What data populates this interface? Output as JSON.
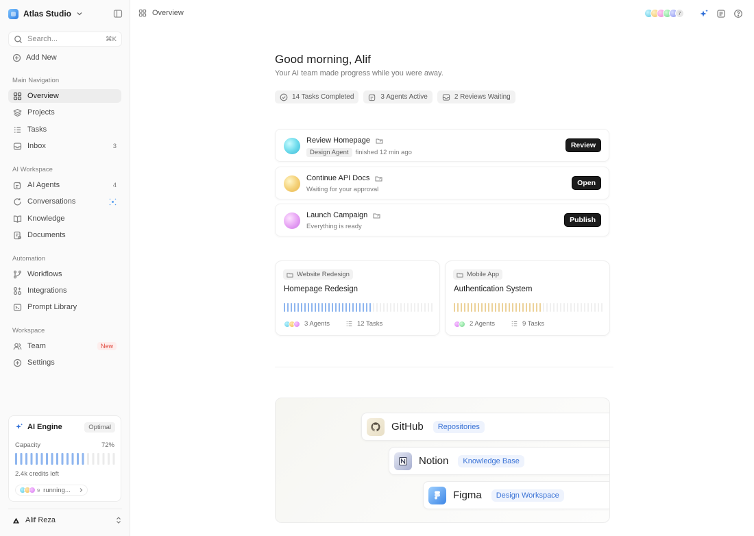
{
  "workspace": {
    "name": "Atlas Studio"
  },
  "search": {
    "placeholder": "Search...",
    "shortcut": "⌘K"
  },
  "add_new": "Add New",
  "sidebar": {
    "sections": [
      {
        "title": "Main Navigation",
        "items": [
          {
            "label": "Overview",
            "icon": "grid-icon",
            "active": true
          },
          {
            "label": "Projects",
            "icon": "layers-icon"
          },
          {
            "label": "Tasks",
            "icon": "list-icon"
          },
          {
            "label": "Inbox",
            "icon": "inbox-icon",
            "count": "3"
          }
        ]
      },
      {
        "title": "AI Workspace",
        "items": [
          {
            "label": "AI Agents",
            "icon": "agent-icon",
            "count": "4"
          },
          {
            "label": "Conversations",
            "icon": "chat-icon"
          },
          {
            "label": "Knowledge",
            "icon": "book-icon"
          },
          {
            "label": "Documents",
            "icon": "document-icon"
          }
        ]
      },
      {
        "title": "Automation",
        "items": [
          {
            "label": "Workflows",
            "icon": "workflow-icon"
          },
          {
            "label": "Integrations",
            "icon": "integrations-icon"
          },
          {
            "label": "Prompt Library",
            "icon": "terminal-icon"
          }
        ]
      },
      {
        "title": "Workspace",
        "items": [
          {
            "label": "Team",
            "icon": "users-icon",
            "badge": "New"
          },
          {
            "label": "Settings",
            "icon": "settings-icon"
          }
        ]
      }
    ]
  },
  "engine": {
    "title": "AI Engine",
    "status": "Optimal",
    "capacity_label": "Capacity",
    "capacity_value": "72%",
    "capacity_fraction": 0.72,
    "credits": "2.4k credits left",
    "running_count": "9",
    "running_label": "running..."
  },
  "user": {
    "name": "Alif Reza"
  },
  "topbar": {
    "breadcrumb": "Overview",
    "avatar_more": "7"
  },
  "greeting": {
    "title": "Good morning, Alif",
    "subtitle": "Your AI team made progress while you were away."
  },
  "stats": [
    {
      "label": "14 Tasks Completed",
      "icon": "check-circle-icon"
    },
    {
      "label": "3 Agents Active",
      "icon": "agent-icon"
    },
    {
      "label": "2 Reviews Waiting",
      "icon": "inbox-icon"
    }
  ],
  "tasks": [
    {
      "title": "Review Homepage",
      "agent": "Design Agent",
      "status": "finished 12 min ago",
      "button": "Review"
    },
    {
      "title": "Continue API Docs",
      "agent": "",
      "status": "Waiting for your approval",
      "button": "Open"
    },
    {
      "title": "Launch Campaign",
      "agent": "",
      "status": "Everything is ready",
      "button": "Publish"
    }
  ],
  "projects": [
    {
      "tag": "Website Redesign",
      "title": "Homepage Redesign",
      "progress": 0.59,
      "color": "#8fb6ef",
      "agents": "3 Agents",
      "tasks": "12 Tasks"
    },
    {
      "tag": "Mobile App",
      "title": "Authentication System",
      "progress": 0.59,
      "color": "#ecd29a",
      "agents": "2 Agents",
      "tasks": "9 Tasks"
    }
  ],
  "integrations": [
    {
      "name": "GitHub",
      "tag": "Repositories"
    },
    {
      "name": "Notion",
      "tag": "Knowledge Base"
    },
    {
      "name": "Figma",
      "tag": "Design Workspace"
    }
  ],
  "colors": {
    "accent_blue": "#8fb6ef",
    "accent_gold": "#ecd29a",
    "new_badge": "#e0483c",
    "integration_tag": "#3a73d6"
  }
}
